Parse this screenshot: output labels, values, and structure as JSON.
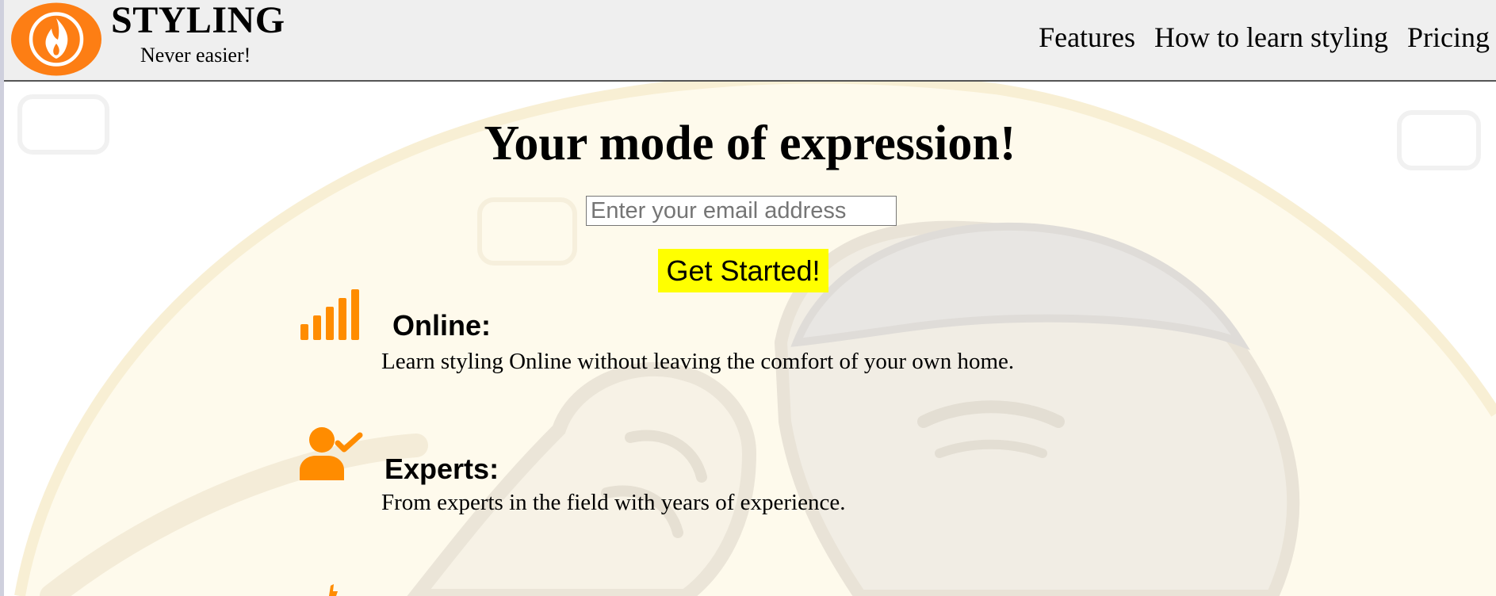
{
  "header": {
    "brand_title": "STYLING",
    "brand_tagline": "Never easier!",
    "nav": [
      {
        "label": "Features"
      },
      {
        "label": "How to learn styling"
      },
      {
        "label": "Pricing"
      }
    ]
  },
  "hero": {
    "title": "Your mode of expression!",
    "email_placeholder": "Enter your email address",
    "email_value": "",
    "cta_label": "Get Started!"
  },
  "features": [
    {
      "icon": "signal-bars-icon",
      "heading": "Online:",
      "description": "Learn styling Online without leaving the comfort of your own home."
    },
    {
      "icon": "user-check-icon",
      "heading": "Experts:",
      "description": "From experts in the field with years of experience."
    }
  ],
  "colors": {
    "brand_orange": "#fd7e14",
    "header_bg": "#efefef",
    "cta_bg": "#ffff00",
    "icon_orange": "#ff8c00"
  }
}
